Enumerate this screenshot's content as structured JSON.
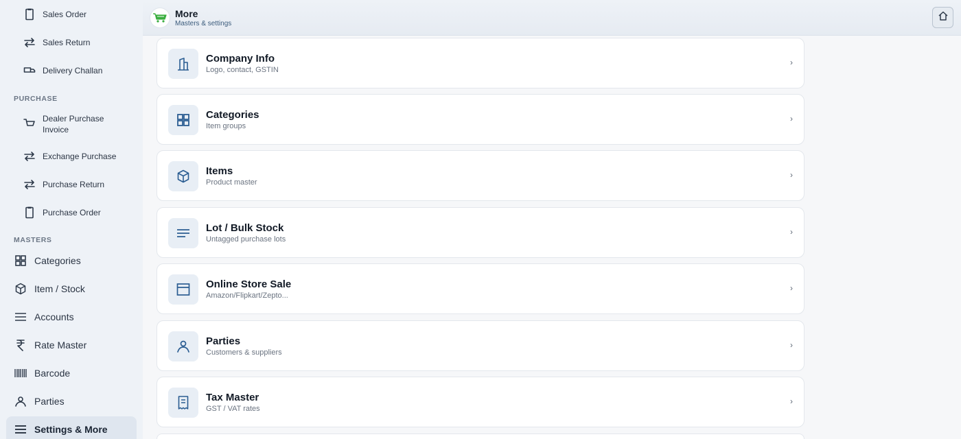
{
  "header": {
    "title": "More",
    "subtitle": "Masters & settings",
    "logo_icon": "cart-logo-icon",
    "home_icon": "home-icon"
  },
  "sidebar": {
    "sales_items": [
      {
        "label": "Sales Order",
        "icon": "clipboard-icon"
      },
      {
        "label": "Sales Return",
        "icon": "swap-icon"
      },
      {
        "label": "Delivery Challan",
        "icon": "truck-icon"
      }
    ],
    "purchase_section": "PURCHASE",
    "purchase_items": [
      {
        "label": "Dealer Purchase Invoice",
        "line1": "Dealer Purchase",
        "line2": "Invoice",
        "icon": "basket-icon"
      },
      {
        "label": "Exchange Purchase",
        "icon": "swap-icon"
      },
      {
        "label": "Purchase Return",
        "icon": "swap-icon"
      },
      {
        "label": "Purchase Order",
        "icon": "clipboard-icon"
      }
    ],
    "masters_section": "MASTERS",
    "masters_items": [
      {
        "label": "Categories",
        "icon": "grid-icon"
      },
      {
        "label": "Item / Stock",
        "icon": "box-icon"
      },
      {
        "label": "Accounts",
        "icon": "list-icon"
      },
      {
        "label": "Rate Master",
        "icon": "rupee-icon"
      },
      {
        "label": "Barcode",
        "icon": "barcode-icon"
      },
      {
        "label": "Parties",
        "icon": "user-icon"
      },
      {
        "label": "Settings & More",
        "icon": "menu-icon",
        "active": true
      }
    ]
  },
  "cards": [
    {
      "title": "Company Info",
      "subtitle": "Logo, contact, GSTIN",
      "icon": "building-icon"
    },
    {
      "title": "Categories",
      "subtitle": "Item groups",
      "icon": "grid-icon"
    },
    {
      "title": "Items",
      "subtitle": "Product master",
      "icon": "box-icon"
    },
    {
      "title": "Lot / Bulk Stock",
      "subtitle": "Untagged purchase lots",
      "icon": "list-icon"
    },
    {
      "title": "Online Store Sale",
      "subtitle": "Amazon/Flipkart/Zepto...",
      "icon": "store-icon"
    },
    {
      "title": "Parties",
      "subtitle": "Customers & suppliers",
      "icon": "user-icon"
    },
    {
      "title": "Tax Master",
      "subtitle": "GST / VAT rates",
      "icon": "receipt-icon"
    }
  ],
  "chevron": "›"
}
